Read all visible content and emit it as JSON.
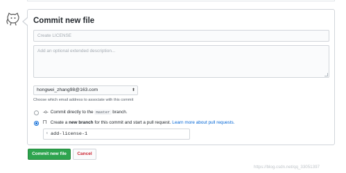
{
  "header": {
    "title": "Commit new file"
  },
  "form": {
    "summary_placeholder": "Create LICENSE",
    "description_placeholder": "Add an optional extended description...",
    "email_value": "hongwei_zhang98@163.com",
    "email_note": "Choose which email address to associate with this commit"
  },
  "options": {
    "direct": {
      "prefix": "Commit directly to the",
      "branch": "master",
      "suffix": "branch.",
      "selected": false
    },
    "new_branch": {
      "prefix": "Create a",
      "bold": "new branch",
      "middle": "for this commit and start a pull request.",
      "link": "Learn more about pull requests.",
      "selected": true
    },
    "branch_name": "add-license-1"
  },
  "actions": {
    "commit_label": "Commit new file",
    "cancel_label": "Cancel"
  },
  "watermark": "https://blog.csdn.net/qq_33051397",
  "colors": {
    "commit": "#2ea44f",
    "cancel_text": "#cb2431",
    "link": "#0366d6"
  },
  "icons": {
    "avatar": "octocat-avatar-icon",
    "commit": "git-commit-icon",
    "branch": "git-branch-icon",
    "caret": "select-caret-icon"
  }
}
